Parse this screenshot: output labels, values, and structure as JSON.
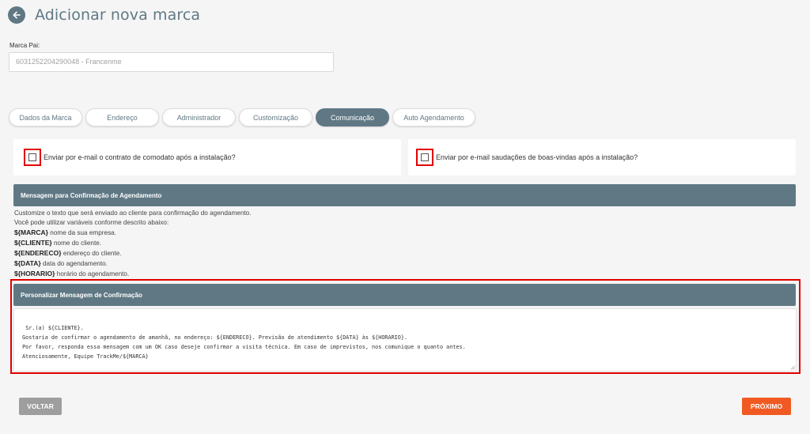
{
  "header": {
    "title": "Adicionar nova marca"
  },
  "parent_brand": {
    "label": "Marca Pai:",
    "value": "6031252204290048 - Francenme"
  },
  "tabs": [
    {
      "label": "Dados da Marca",
      "active": false
    },
    {
      "label": "Endereço",
      "active": false
    },
    {
      "label": "Administrador",
      "active": false
    },
    {
      "label": "Customização",
      "active": false
    },
    {
      "label": "Comunicação",
      "active": true
    },
    {
      "label": "Auto Agendamento",
      "active": false
    }
  ],
  "checks": {
    "contract_email": "Enviar por e-mail o contrato de comodato após a instalação?",
    "welcome_email": "Enviar por e-mail saudações de boas-vindas após a instalação?"
  },
  "confirmation": {
    "section_title": "Mensagem para Confirmação de Agendamento",
    "intro1": "Customize o texto que será enviado ao cliente para confirmação do agendamento.",
    "intro2": "Você pode utilizar variáveis conforme descrito abaixo:",
    "variables": [
      {
        "name": "${MARCA}",
        "desc": "nome da sua empresa."
      },
      {
        "name": "${CLIENTE}",
        "desc": "nome do cliente."
      },
      {
        "name": "${ENDERECO}",
        "desc": "endereço do cliente."
      },
      {
        "name": "${DATA}",
        "desc": "data do agendamento."
      },
      {
        "name": "${HORARIO}",
        "desc": "horário do agendamento."
      }
    ],
    "custom_title": "Personalizar Mensagem de Confirmação",
    "message": "Sr.(a) ${CLIENTE}.\n Gostaria de confirmar o agendamento de amanhã, no endereço: ${ENDERECO}. Previsão de atendimento ${DATA} às ${HORARIO}.\n Por favor, responda essa mensagem com um OK caso deseje confirmar a visita técnica. Em caso de imprevistos, nos comunique o quanto antes.\n Atenciosamente, Equipe TrackMe/${MARCA}"
  },
  "buttons": {
    "back": "VOLTAR",
    "next": "PRÓXIMO"
  },
  "colors": {
    "primary": "#5f7884",
    "accent": "#f05a22",
    "highlight": "#e00000"
  }
}
